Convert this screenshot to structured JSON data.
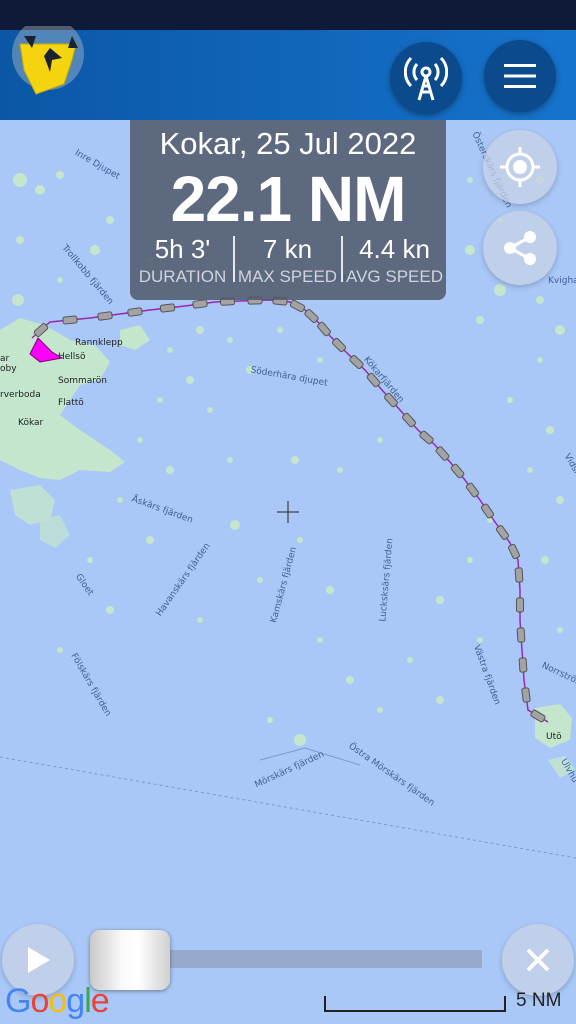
{
  "header": {
    "logo_icon": "compass-boat-logo-icon",
    "broadcast_icon": "broadcast-antenna-icon",
    "menu_icon": "hamburger-menu-icon"
  },
  "trip": {
    "title": "Kokar, 25 Jul 2022",
    "distance": "22.1 NM",
    "stats": [
      {
        "value": "5h 3'",
        "label": "DURATION"
      },
      {
        "value": "7 kn",
        "label": "MAX SPEED"
      },
      {
        "value": "4.4 kn",
        "label": "AVG SPEED"
      }
    ]
  },
  "map_controls": {
    "locate_icon": "crosshair-target-icon",
    "share_icon": "share-icon",
    "play_icon": "play-icon",
    "close_icon": "close-icon",
    "playback_position": 0
  },
  "map": {
    "water_color": "#a9c8f7",
    "land_color": "#c3e6cc",
    "track_color": "#9c27b0",
    "boat_color": "#ff00ff",
    "places": [
      "Rannklepp",
      "Hellsö",
      "Sommarön",
      "Flattö",
      "Kökar",
      "rverboda",
      "ar",
      "oby",
      "Utö"
    ],
    "water_labels": [
      "Inre Djupet",
      "Österskärs fjärden",
      "Trollkobb fjärden",
      "Kvighar",
      "Söderhära djupet",
      "Kökarfjärden",
      "Vidsk",
      "Åskärs fjärden",
      "Havanskärs fjärden",
      "Gloet",
      "Kamskärs fjärden",
      "Lucksksärs fjärden",
      "Västra fjärden",
      "Norrström",
      "Fölskärs fjärden",
      "Mörskärs fjärden",
      "Östra Mörskärs fjärden",
      "Ulvhu",
      "djupet"
    ]
  },
  "attribution": "Google",
  "scale": "5 NM"
}
